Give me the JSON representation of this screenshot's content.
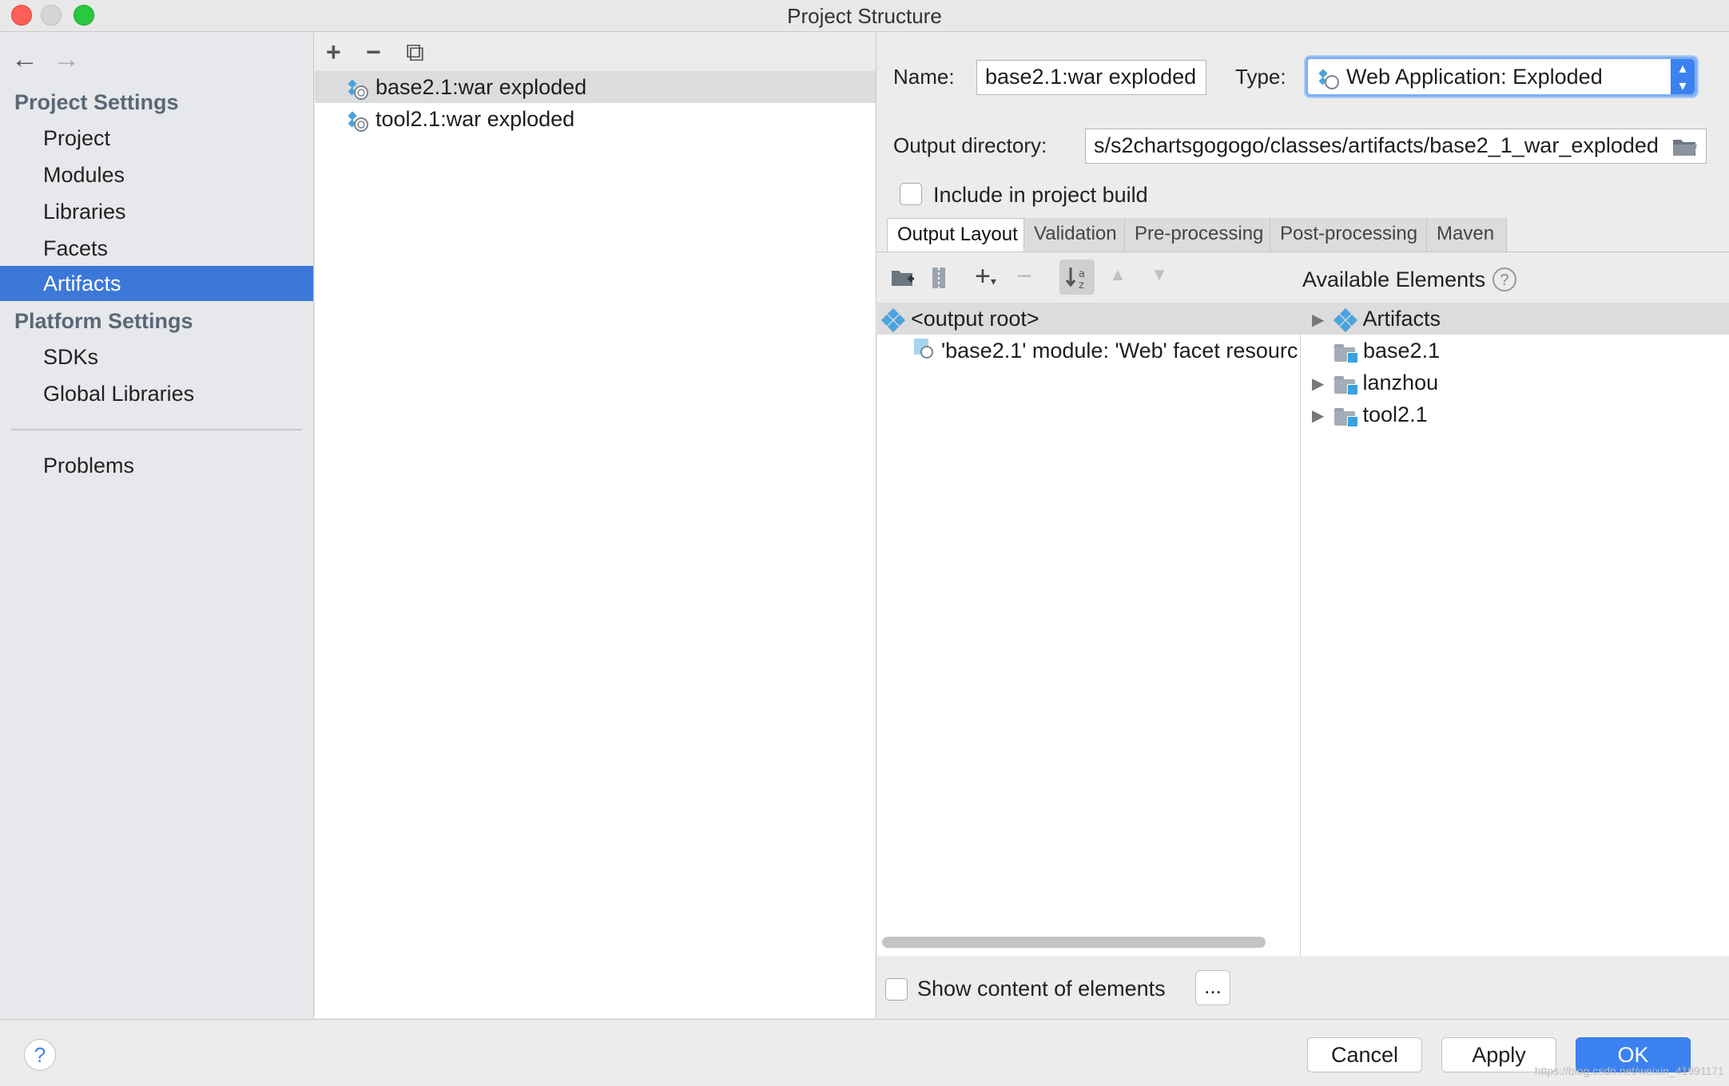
{
  "window": {
    "title": "Project Structure"
  },
  "nav": {
    "back": "←",
    "forward": "→"
  },
  "sidebar": {
    "project_settings_title": "Project Settings",
    "project_settings_items": [
      "Project",
      "Modules",
      "Libraries",
      "Facets",
      "Artifacts"
    ],
    "platform_settings_title": "Platform Settings",
    "platform_settings_items": [
      "SDKs",
      "Global Libraries"
    ],
    "problems": "Problems",
    "selected": "Artifacts"
  },
  "artifacts_list": {
    "toolbar": {
      "add": "+",
      "remove": "−",
      "copy": "⧉"
    },
    "items": [
      "base2.1:war exploded",
      "tool2.1:war exploded"
    ],
    "selected_index": 0
  },
  "detail": {
    "name_label": "Name:",
    "name_value": "base2.1:war exploded",
    "type_label": "Type:",
    "type_value": "Web Application: Exploded",
    "output_dir_label": "Output directory:",
    "output_dir_value": "s/s2chartsgogogo/classes/artifacts/base2_1_war_exploded",
    "include_label": "Include in project build",
    "include_checked": false,
    "tabs": [
      "Output Layout",
      "Validation",
      "Pre-processing",
      "Post-processing",
      "Maven"
    ],
    "selected_tab": "Output Layout",
    "available_elements_label": "Available Elements",
    "output_tree": {
      "root": "<output root>",
      "children": [
        "'base2.1' module: 'Web' facet resourc"
      ]
    },
    "available_tree": [
      {
        "label": "Artifacts",
        "expandable": true,
        "icon": "artifact-icon"
      },
      {
        "label": "base2.1",
        "expandable": false,
        "icon": "module-folder-icon"
      },
      {
        "label": "lanzhou",
        "expandable": true,
        "icon": "module-folder-icon"
      },
      {
        "label": "tool2.1",
        "expandable": true,
        "icon": "module-folder-icon"
      }
    ],
    "show_content_label": "Show content of elements",
    "show_content_checked": false,
    "ellipsis_button": "..."
  },
  "footer": {
    "help": "?",
    "cancel": "Cancel",
    "apply": "Apply",
    "ok": "OK",
    "watermark": "https://blog.csdn.net/weixin_41991171"
  },
  "colors": {
    "accent": "#3c78d8",
    "primary_button": "#3b82f0"
  }
}
